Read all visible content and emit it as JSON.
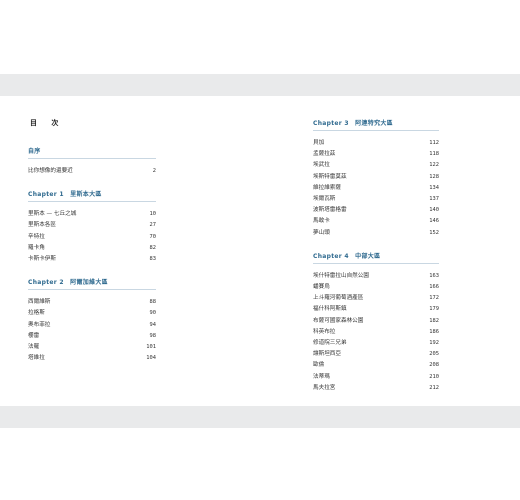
{
  "toc_title": "目 次",
  "left": {
    "preface": {
      "heading": "自序",
      "entries": [
        {
          "title": "比你想像的還要近",
          "page": "2"
        }
      ]
    },
    "chapter1": {
      "heading": "Chapter 1　里斯本大區",
      "entries": [
        {
          "title": "里斯本 — 七丘之城",
          "page": "10"
        },
        {
          "title": "里斯本各區",
          "page": "27"
        },
        {
          "title": "辛特拉",
          "page": "70"
        },
        {
          "title": "羅卡角",
          "page": "82"
        },
        {
          "title": "卡斯卡伊斯",
          "page": "83"
        }
      ]
    },
    "chapter2": {
      "heading": "Chapter 2　阿爾加維大區",
      "entries": [
        {
          "title": "西爾維斯",
          "page": "88"
        },
        {
          "title": "拉格斯",
          "page": "90"
        },
        {
          "title": "奧布菲拉",
          "page": "94"
        },
        {
          "title": "櫻雷",
          "page": "98"
        },
        {
          "title": "法羅",
          "page": "101"
        },
        {
          "title": "塔維拉",
          "page": "104"
        }
      ]
    }
  },
  "right": {
    "chapter3": {
      "heading": "Chapter 3　阿連特究大區",
      "entries": [
        {
          "title": "貝加",
          "page": "112"
        },
        {
          "title": "孟薩拉茲",
          "page": "118"
        },
        {
          "title": "埃武拉",
          "page": "122"
        },
        {
          "title": "埃斯特雷莫茲",
          "page": "128"
        },
        {
          "title": "維拉維索薩",
          "page": "134"
        },
        {
          "title": "埃爾瓦斯",
          "page": "137"
        },
        {
          "title": "波斯塔雷格雷",
          "page": "140"
        },
        {
          "title": "馬敢卡",
          "page": "146"
        },
        {
          "title": "夢山頭",
          "page": "152"
        }
      ]
    },
    "chapter4": {
      "heading": "Chapter 4　中部大區",
      "entries": [
        {
          "title": "埃什特雷拉山自然公園",
          "page": "163"
        },
        {
          "title": "蟠賽烏",
          "page": "166"
        },
        {
          "title": "上斗羅河葡萄酒產區",
          "page": "172"
        },
        {
          "title": "福什科阿斯鎮",
          "page": "179"
        },
        {
          "title": "布薩可國家森林公園",
          "page": "182"
        },
        {
          "title": "科英布拉",
          "page": "186"
        },
        {
          "title": "修道院三兄弟",
          "page": "192"
        },
        {
          "title": "讓斯坦西亞",
          "page": "205"
        },
        {
          "title": "歐倫",
          "page": "208"
        },
        {
          "title": "法蒂瑪",
          "page": "210"
        },
        {
          "title": "馬夫拉宮",
          "page": "212"
        }
      ]
    }
  }
}
